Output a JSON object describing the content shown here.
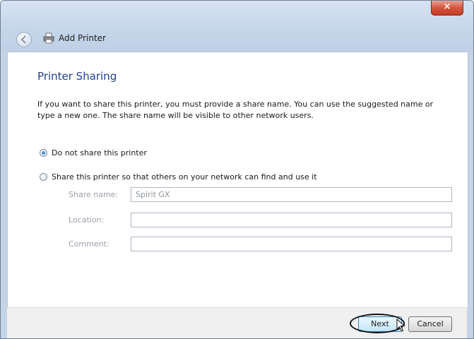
{
  "window": {
    "title": "Add Printer",
    "close_symbol": "×"
  },
  "page": {
    "heading": "Printer Sharing",
    "description": "If you want to share this printer, you must provide a share name. You can use the suggested name or type a new one. The share name will be visible to other network users."
  },
  "sharing_options": [
    {
      "label": "Do not share this printer",
      "selected": true
    },
    {
      "label": "Share this printer so that others on your network can find and use it",
      "selected": false
    }
  ],
  "fields": {
    "share_name": {
      "label": "Share name:",
      "value": "Spirit GX"
    },
    "location": {
      "label": "Location:",
      "value": ""
    },
    "comment": {
      "label": "Comment:",
      "value": ""
    }
  },
  "buttons": {
    "next": "Next",
    "cancel": "Cancel"
  },
  "icons": {
    "back": "back-arrow-icon",
    "title": "printer-icon",
    "close": "close-icon",
    "cursor": "mouse-pointer-icon"
  },
  "colors": {
    "heading": "#1f3f8f",
    "close_button": "#c43b25",
    "next_button_border": "#3c7fb1"
  }
}
